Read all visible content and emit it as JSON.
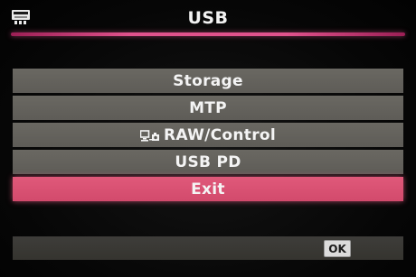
{
  "header": {
    "title": "USB",
    "icon": "setup-menu-icon",
    "accent_color": "#e0528c"
  },
  "menu": {
    "items": [
      {
        "label": "Storage",
        "selected": false
      },
      {
        "label": "MTP",
        "selected": false
      },
      {
        "label": "RAW/Control",
        "icon": "pc-camera-icon",
        "selected": false
      },
      {
        "label": "USB PD",
        "selected": false
      },
      {
        "label": "Exit",
        "selected": true
      }
    ],
    "selected_color": "#d24a6c",
    "item_color": "#64625c"
  },
  "footer": {
    "ok_label": "OK"
  }
}
